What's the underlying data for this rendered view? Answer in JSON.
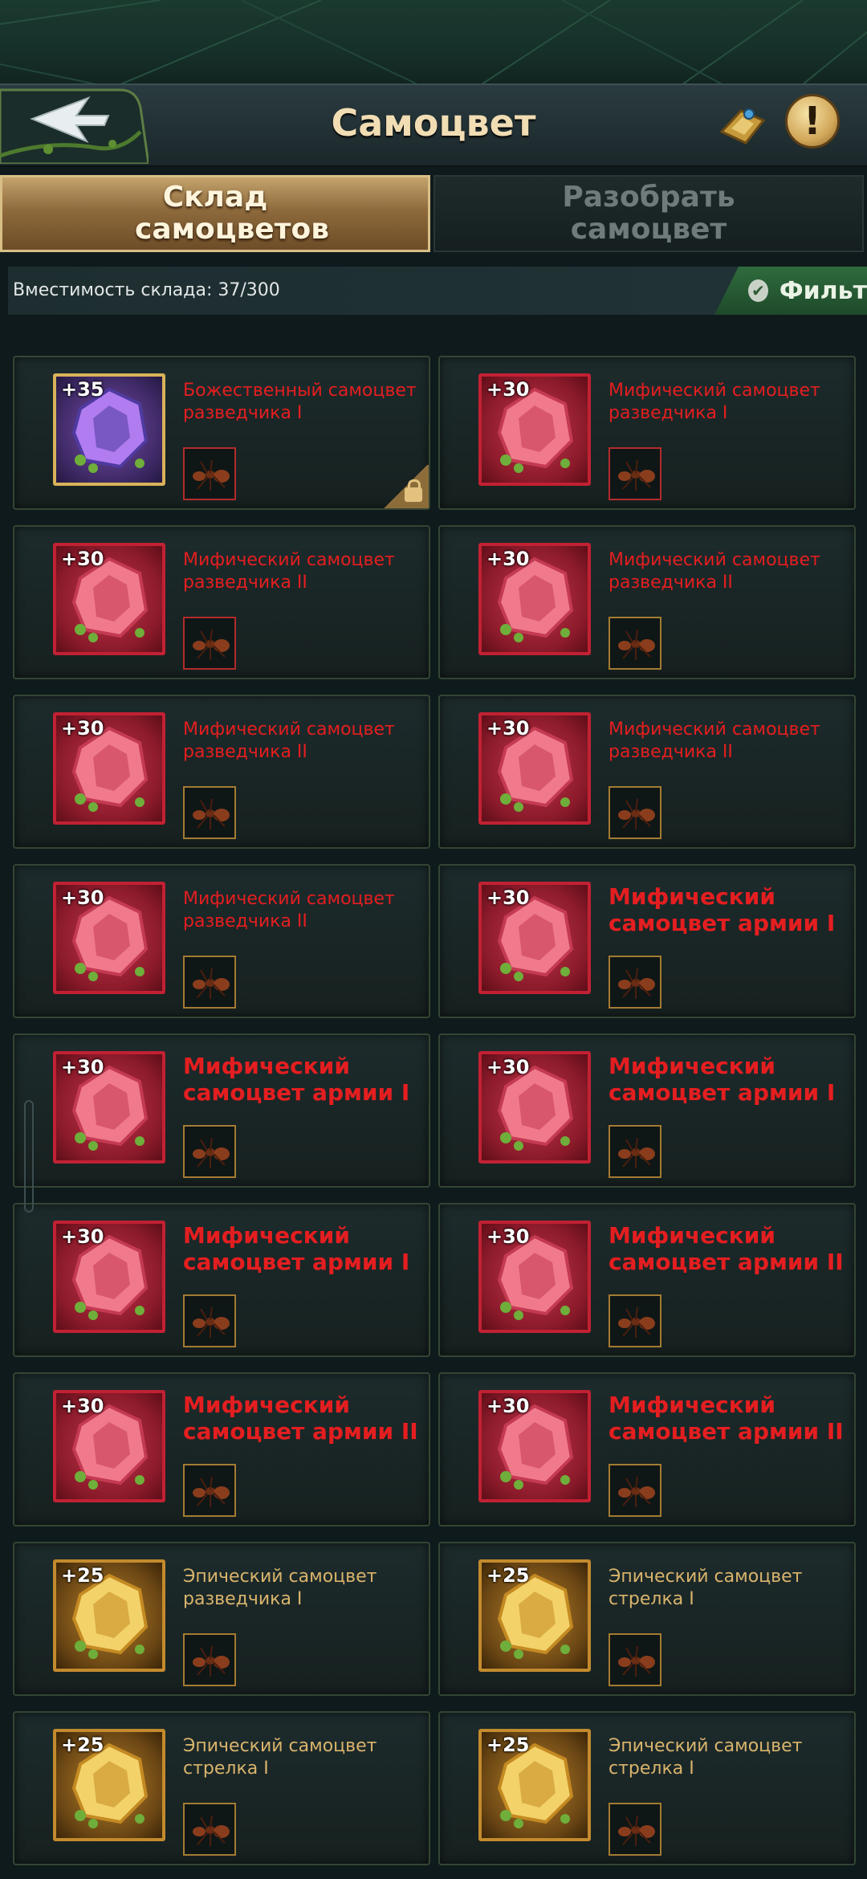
{
  "header": {
    "title": "Самоцвет",
    "back_icon": "back-arrow-icon",
    "badge_icon": "gem-book-icon",
    "info_icon": "exclamation-icon",
    "info_text": "!"
  },
  "tabs": [
    {
      "label": "Склад самоцветов",
      "active": true
    },
    {
      "label": "Разобрать самоцвет",
      "active": false
    }
  ],
  "capacity": {
    "text": "Вместимость склада: 37/300"
  },
  "filter": {
    "label": "Фильт",
    "icon": "check-icon"
  },
  "colors": {
    "mythic": "#e41e20",
    "epic": "#d9b46c",
    "accent_green": "#2f6b3d"
  },
  "gems": [
    {
      "level": "+35",
      "name": "Божественный самоцвет разведчика I",
      "rarity": "divine",
      "locked": true
    },
    {
      "level": "+30",
      "name": "Мифический самоцвет разведчика I",
      "rarity": "mythic"
    },
    {
      "level": "+30",
      "name": "Мифический самоцвет разведчика II",
      "rarity": "mythic"
    },
    {
      "level": "+30",
      "name": "Мифический самоцвет разведчика II",
      "rarity": "mythic"
    },
    {
      "level": "+30",
      "name": "Мифический самоцвет разведчика II",
      "rarity": "mythic"
    },
    {
      "level": "+30",
      "name": "Мифический самоцвет разведчика II",
      "rarity": "mythic"
    },
    {
      "level": "+30",
      "name": "Мифический самоцвет разведчика II",
      "rarity": "mythic"
    },
    {
      "level": "+30",
      "name": "Мифический самоцвет армии I",
      "rarity": "mythic",
      "large": true
    },
    {
      "level": "+30",
      "name": "Мифический самоцвет армии I",
      "rarity": "mythic",
      "large": true
    },
    {
      "level": "+30",
      "name": "Мифический самоцвет армии I",
      "rarity": "mythic",
      "large": true
    },
    {
      "level": "+30",
      "name": "Мифический самоцвет армии I",
      "rarity": "mythic",
      "large": true
    },
    {
      "level": "+30",
      "name": "Мифический самоцвет армии II",
      "rarity": "mythic",
      "large": true
    },
    {
      "level": "+30",
      "name": "Мифический самоцвет армии II",
      "rarity": "mythic",
      "large": true
    },
    {
      "level": "+30",
      "name": "Мифический самоцвет армии II",
      "rarity": "mythic",
      "large": true
    },
    {
      "level": "+25",
      "name": "Эпический самоцвет разведчика I",
      "rarity": "epic"
    },
    {
      "level": "+25",
      "name": "Эпический самоцвет стрелка I",
      "rarity": "epic"
    },
    {
      "level": "+25",
      "name": "Эпический самоцвет стрелка I",
      "rarity": "epic"
    },
    {
      "level": "+25",
      "name": "Эпический самоцвет стрелка I",
      "rarity": "epic"
    }
  ]
}
